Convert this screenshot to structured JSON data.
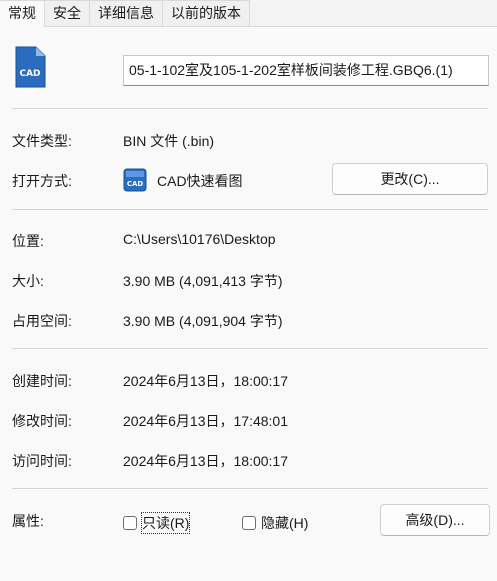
{
  "tabs": [
    {
      "label": "常规"
    },
    {
      "label": "安全"
    },
    {
      "label": "详细信息"
    },
    {
      "label": "以前的版本"
    }
  ],
  "file": {
    "name": "05-1-102室及105-1-202室样板间装修工程.GBQ6.(1)"
  },
  "type": {
    "label": "文件类型:",
    "value": "BIN 文件 (.bin)"
  },
  "opens_with": {
    "label": "打开方式:",
    "app": "CAD快速看图",
    "change_button": "更改(C)..."
  },
  "location": {
    "label": "位置:",
    "value": "C:\\Users\\10176\\Desktop"
  },
  "size": {
    "label": "大小:",
    "value": "3.90 MB (4,091,413 字节)"
  },
  "size_on_disk": {
    "label": "占用空间:",
    "value": "3.90 MB (4,091,904 字节)"
  },
  "created": {
    "label": "创建时间:",
    "value": "2024年6月13日，18:00:17"
  },
  "modified": {
    "label": "修改时间:",
    "value": "2024年6月13日，17:48:01"
  },
  "accessed": {
    "label": "访问时间:",
    "value": "2024年6月13日，18:00:17"
  },
  "attributes": {
    "label": "属性:",
    "readonly": {
      "label": "只读(R)",
      "checked": false
    },
    "hidden": {
      "label": "隐藏(H)",
      "checked": false
    },
    "advanced_button": "高级(D)..."
  },
  "icons": {
    "file": "cad-file-icon",
    "app": "cad-app-icon"
  },
  "colors": {
    "cad_blue": "#1f5fa8",
    "cad_light": "#3d8ad6"
  }
}
